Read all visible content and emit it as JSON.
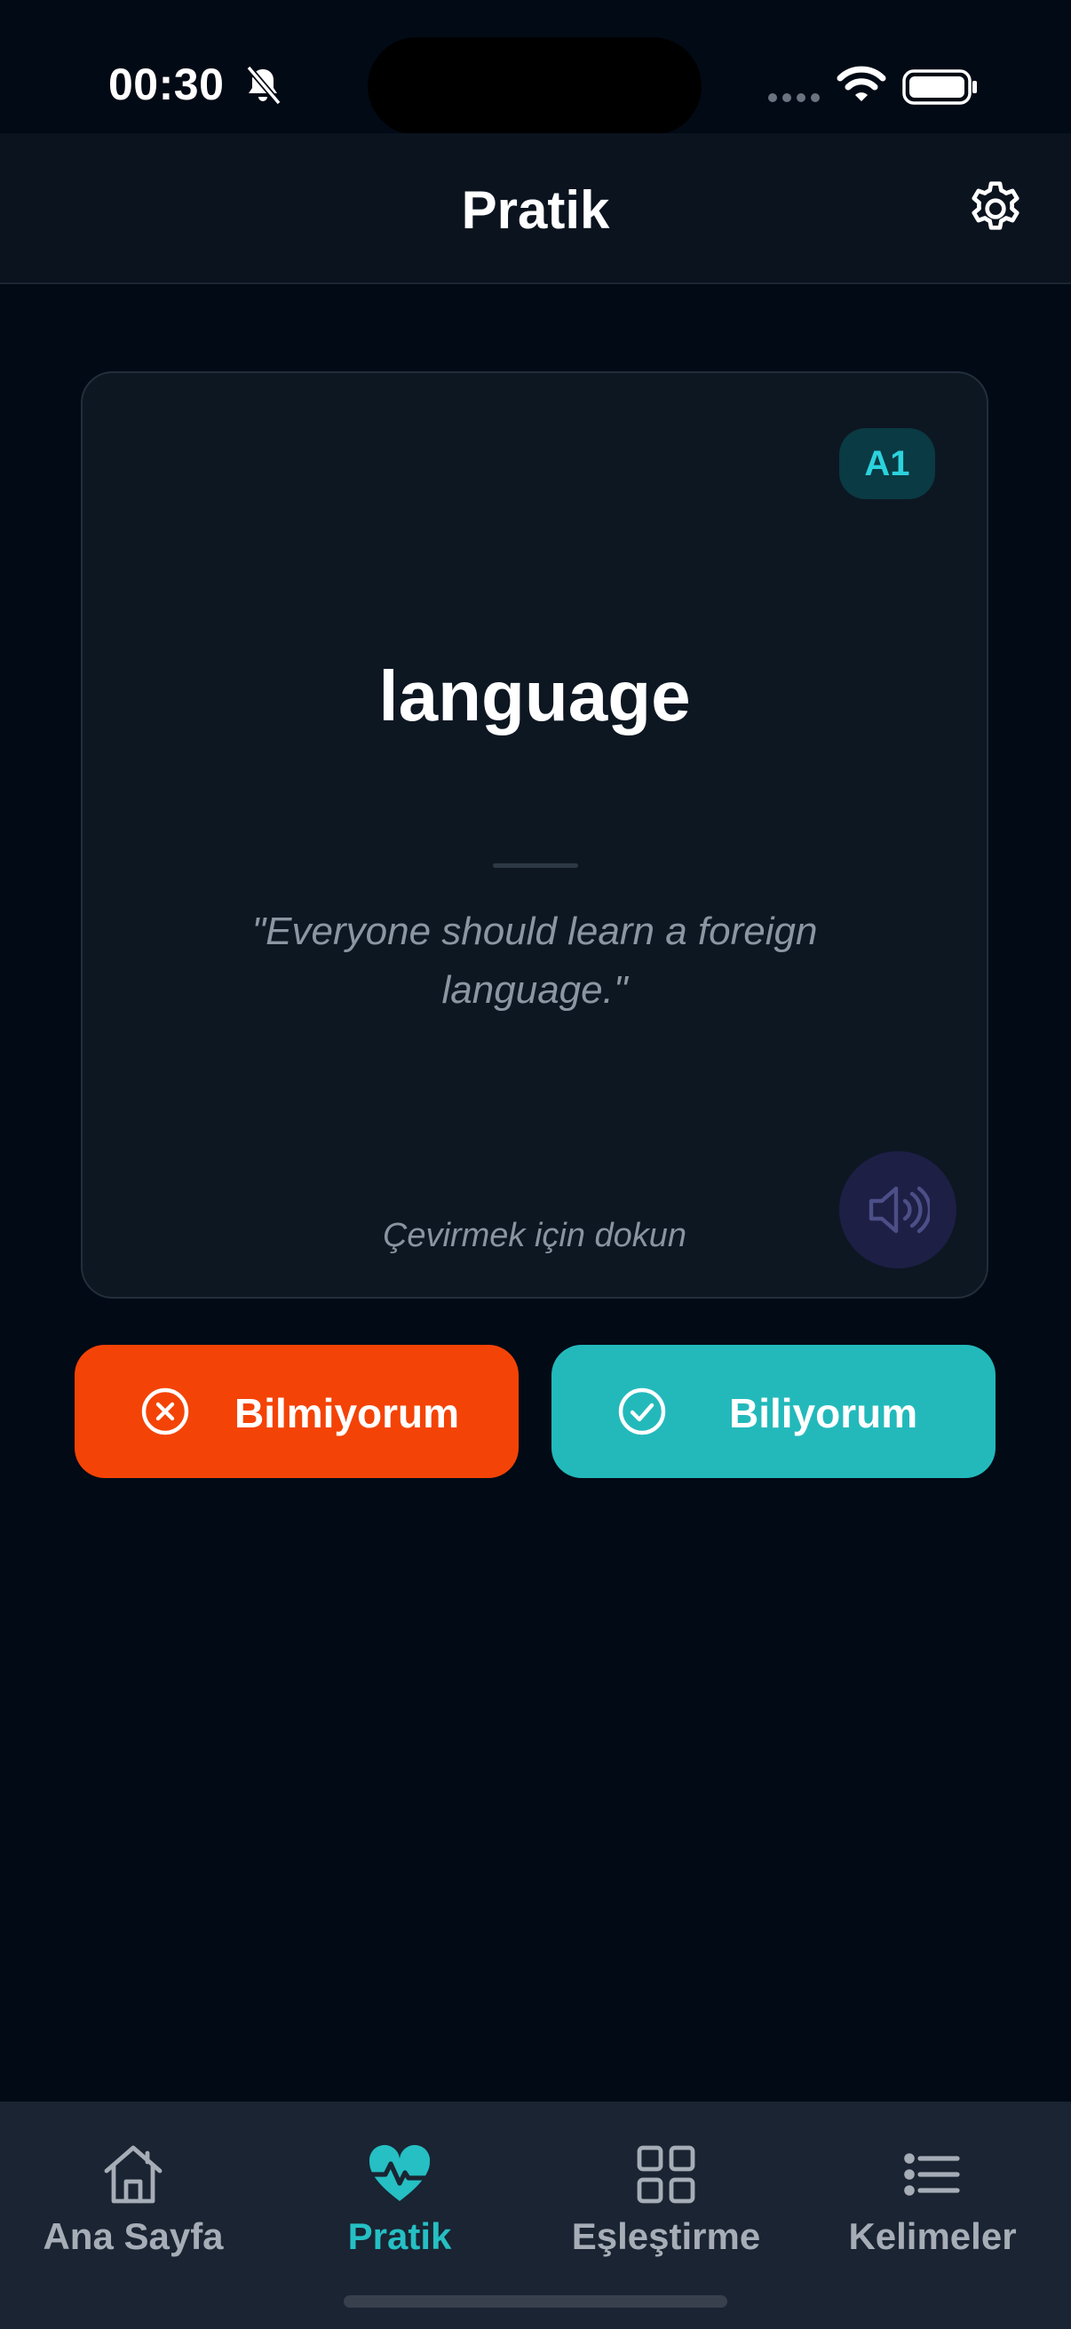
{
  "status_bar": {
    "time": "00:30"
  },
  "header": {
    "title": "Pratik"
  },
  "card": {
    "level": "A1",
    "word": "language",
    "example": "\"Everyone should learn a foreign language.\"",
    "hint": "Çevirmek için dokun"
  },
  "actions": {
    "dont_know": "Bilmiyorum",
    "know": "Biliyorum"
  },
  "tabs": [
    {
      "label": "Ana Sayfa",
      "icon": "home-icon",
      "active": false
    },
    {
      "label": "Pratik",
      "icon": "heart-pulse-icon",
      "active": true
    },
    {
      "label": "Eşleştirme",
      "icon": "grid-icon",
      "active": false
    },
    {
      "label": "Kelimeler",
      "icon": "list-icon",
      "active": false
    }
  ],
  "colors": {
    "background": "#020a15",
    "accent": "#23b9bb",
    "danger": "#f44306",
    "card": "#0d1722",
    "tabbar": "#1a2432"
  }
}
